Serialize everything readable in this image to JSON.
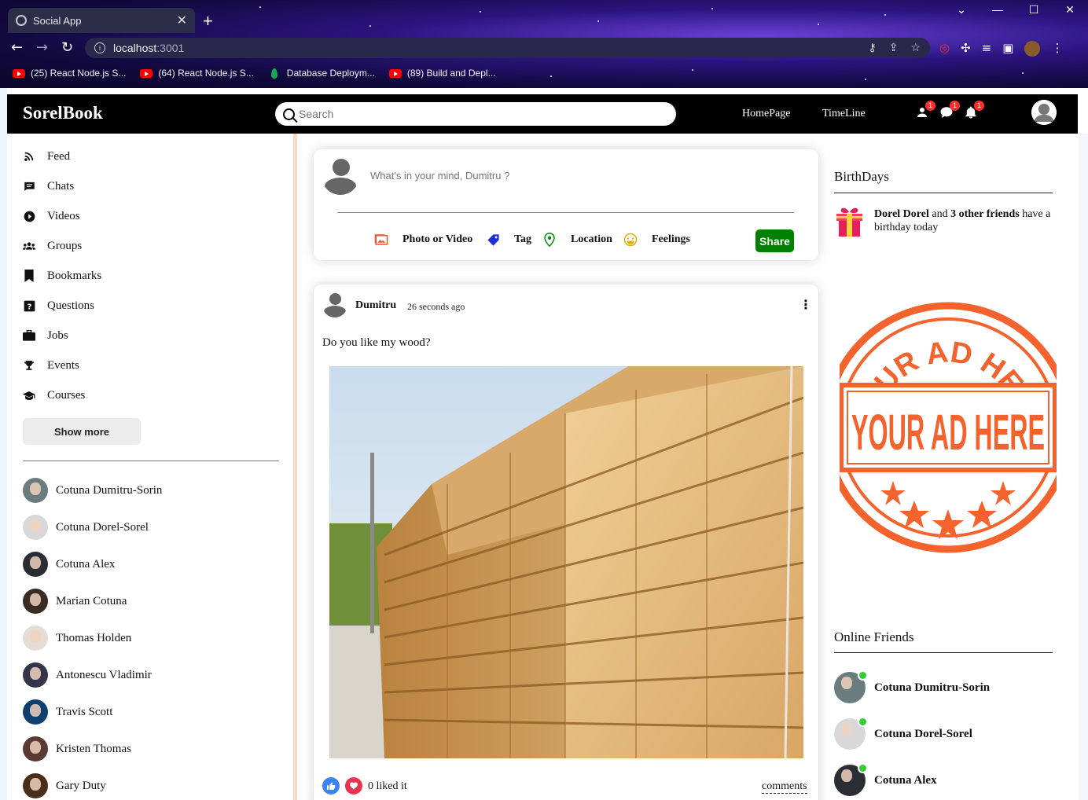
{
  "browser": {
    "tab_title": "Social App",
    "new_tab_icon": "+",
    "url_host": "localhost",
    "url_port": ":3001",
    "bookmarks": [
      {
        "label": "(25) React Node.js S...",
        "icon": "youtube-icon"
      },
      {
        "label": "(64) React Node.js S...",
        "icon": "youtube-icon"
      },
      {
        "label": "Database Deploym...",
        "icon": "mongodb-icon"
      },
      {
        "label": "(89) Build and Depl...",
        "icon": "youtube-icon"
      }
    ]
  },
  "topbar": {
    "logo": "SorelBook",
    "search_placeholder": "Search",
    "links": [
      "HomePage",
      "TimeLine"
    ],
    "badges": {
      "friend_requests": "1",
      "messages": "1",
      "notifications": "1"
    }
  },
  "sidebar": {
    "menu": [
      {
        "label": "Feed",
        "icon": "rss-feed-icon"
      },
      {
        "label": "Chats",
        "icon": "chat-icon"
      },
      {
        "label": "Videos",
        "icon": "play-circle-icon"
      },
      {
        "label": "Groups",
        "icon": "group-icon"
      },
      {
        "label": "Bookmarks",
        "icon": "bookmark-icon"
      },
      {
        "label": "Questions",
        "icon": "help-icon"
      },
      {
        "label": "Jobs",
        "icon": "briefcase-icon"
      },
      {
        "label": "Events",
        "icon": "trophy-icon"
      },
      {
        "label": "Courses",
        "icon": "school-icon"
      }
    ],
    "show_more": "Show more",
    "friends": [
      "Cotuna Dumitru-Sorin",
      "Cotuna Dorel-Sorel",
      "Cotuna Alex",
      "Marian Cotuna",
      "Thomas Holden",
      "Antonescu Vladimir",
      "Travis Scott",
      "Kristen Thomas",
      "Gary Duty"
    ]
  },
  "share": {
    "placeholder": "What's in your mind, Dumitru ?",
    "options": [
      {
        "label": "Photo or Video",
        "icon": "photo-icon",
        "color": "#f05033"
      },
      {
        "label": "Tag",
        "icon": "label-icon",
        "color": "#1e2fd6"
      },
      {
        "label": "Location",
        "icon": "location-pin-icon",
        "color": "#0a8a0a"
      },
      {
        "label": "Feelings",
        "icon": "emoji-icon",
        "color": "#e0b100"
      }
    ],
    "button": "Share"
  },
  "post": {
    "username": "Dumitru",
    "time": "26 seconds ago",
    "text": "Do you like my wood?",
    "likes": "0 liked it",
    "comments": "comments"
  },
  "right": {
    "birthdays_title": "BirthDays",
    "birthday_name": "Dorel Dorel",
    "birthday_and": " and ",
    "birthday_count": "3 other friends",
    "birthday_rest": " have a birthday today",
    "ad_text_top": "YOUR AD HERE",
    "ad_text_main": "YOUR AD HERE",
    "online_title": "Online Friends",
    "online_friends": [
      "Cotuna Dumitru-Sorin",
      "Cotuna Dorel-Sorel",
      "Cotuna Alex"
    ]
  },
  "colors": {
    "accent_green": "#008000",
    "badge_red": "#ff2d2d",
    "online_green": "#32cd32",
    "ad_orange": "#f4622d",
    "like_blue": "#3b82f6",
    "heart_red": "#e8344e"
  }
}
